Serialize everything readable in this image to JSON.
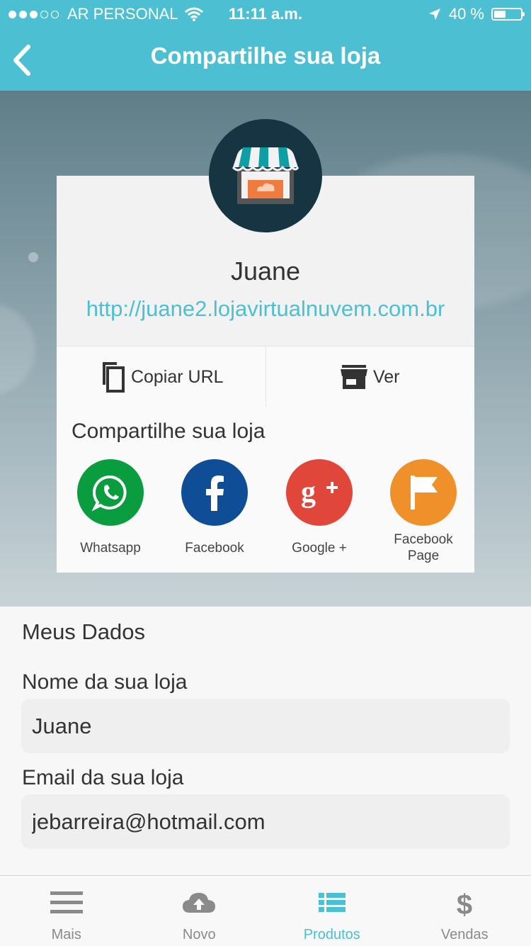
{
  "status_bar": {
    "carrier": "AR PERSONAL",
    "time": "11:11 a.m.",
    "battery": "40 %",
    "battery_level": 0.4,
    "signal_bars": 3,
    "signal_total": 5
  },
  "nav": {
    "title": "Compartilhe sua loja",
    "back_icon": "chevron-left-icon"
  },
  "store": {
    "name": "Juane",
    "url": "http://juane2.lojavirtualnuvem.com.br"
  },
  "actions": {
    "copy_label": "Copiar URL",
    "copy_icon": "copy-icon",
    "view_label": "Ver",
    "view_icon": "store-icon"
  },
  "share": {
    "title": "Compartilhe sua loja",
    "items": [
      {
        "label": "Whatsapp",
        "icon": "whatsapp-icon",
        "color": "#0a9d3f"
      },
      {
        "label": "Facebook",
        "icon": "facebook-icon",
        "color": "#0f4e96"
      },
      {
        "label": "Google +",
        "icon": "google-plus-icon",
        "color": "#e0463a"
      },
      {
        "label": "Facebook Page",
        "icon": "flag-icon",
        "color": "#f0902b"
      }
    ]
  },
  "form": {
    "section_title": "Meus Dados",
    "name_label": "Nome da sua loja",
    "name_value": "Juane",
    "email_label": "Email da sua loja",
    "email_value": "jebarreira@hotmail.com"
  },
  "tabbar": {
    "items": [
      {
        "label": "Mais",
        "icon": "menu-icon",
        "active": false
      },
      {
        "label": "Novo",
        "icon": "cloud-upload-icon",
        "active": false
      },
      {
        "label": "Produtos",
        "icon": "list-icon",
        "active": true
      },
      {
        "label": "Vendas",
        "icon": "dollar-icon",
        "active": false
      }
    ]
  },
  "colors": {
    "accent": "#4dbfd3",
    "avatar_bg": "#163441"
  }
}
